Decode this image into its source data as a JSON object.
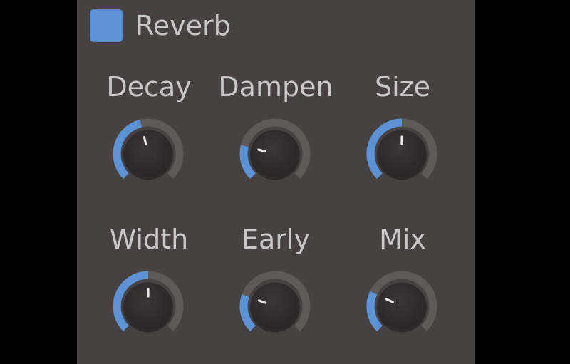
{
  "plugin": {
    "title": "Reverb",
    "enabled": true
  },
  "colors": {
    "background": "#000000",
    "panel": "#474241",
    "accent": "#5b93d6",
    "track": "#5e5a58",
    "knob_body": "#2a2627",
    "label_text": "#c8c8c8",
    "pointer": "#e8e8e8"
  },
  "knobs": [
    {
      "id": "decay",
      "label": "Decay",
      "value": 0.45
    },
    {
      "id": "dampen",
      "label": "Dampen",
      "value": 0.22
    },
    {
      "id": "size",
      "label": "Size",
      "value": 0.5
    },
    {
      "id": "width",
      "label": "Width",
      "value": 0.5
    },
    {
      "id": "early",
      "label": "Early",
      "value": 0.24
    },
    {
      "id": "mix",
      "label": "Mix",
      "value": 0.26
    }
  ]
}
